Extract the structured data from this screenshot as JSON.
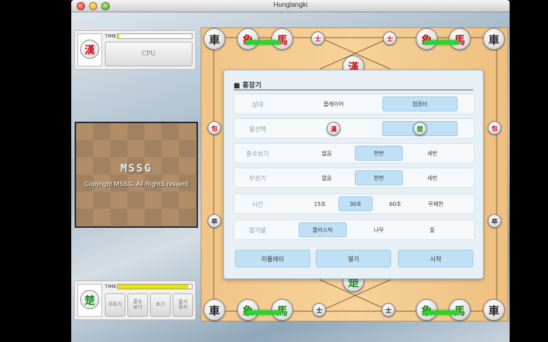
{
  "window": {
    "title": "Hunglangki"
  },
  "top_player": {
    "piece": "漢",
    "time_label": "TIME",
    "time_fraction": 0.02,
    "name_button": "CPU"
  },
  "bottom_player": {
    "piece": "楚",
    "time_label": "TIME",
    "time_fraction": 0.95,
    "buttons": [
      "무르기",
      "훈수\n보기",
      "포기",
      "일시\n정지"
    ]
  },
  "logo": {
    "mark": "MSSG",
    "copyright": "Copyright MSSG, All RightS resverd"
  },
  "dialog": {
    "title": "■ 홍장기",
    "rows": [
      {
        "label": "상대",
        "options": [
          "플레이어",
          "컴퓨터"
        ],
        "selected": 1
      },
      {
        "label": "알선택",
        "options": [
          "漢",
          "楚"
        ],
        "selected": 1
      },
      {
        "label": "훈수보기",
        "options": [
          "없음",
          "한번",
          "세번"
        ],
        "selected": 1
      },
      {
        "label": "무르기",
        "options": [
          "없음",
          "한번",
          "세번"
        ],
        "selected": 1
      },
      {
        "label": "시간",
        "options": [
          "15초",
          "30초",
          "60초",
          "무제한"
        ],
        "selected": 1
      },
      {
        "label": "장기알",
        "options": [
          "플라스틱",
          "나무",
          "돌"
        ],
        "selected": 0
      }
    ],
    "buttons": [
      "리플레이",
      "열기",
      "시작"
    ]
  },
  "board_pieces": {
    "top_row": [
      "車",
      "象",
      "馬",
      "士",
      "士",
      "象",
      "馬",
      "車"
    ],
    "top_general": "漢",
    "side_left": [
      "包",
      "卒"
    ],
    "side_right": [
      "包",
      "卒"
    ],
    "bottom_row": [
      "車",
      "象",
      "馬",
      "士",
      "士",
      "象",
      "馬",
      "車"
    ],
    "bottom_general": "楚"
  },
  "colors": {
    "han": "#c8101a",
    "cho": "#1a8a1a",
    "chariot": "#222222",
    "selected_option": "#bfe0f5"
  }
}
